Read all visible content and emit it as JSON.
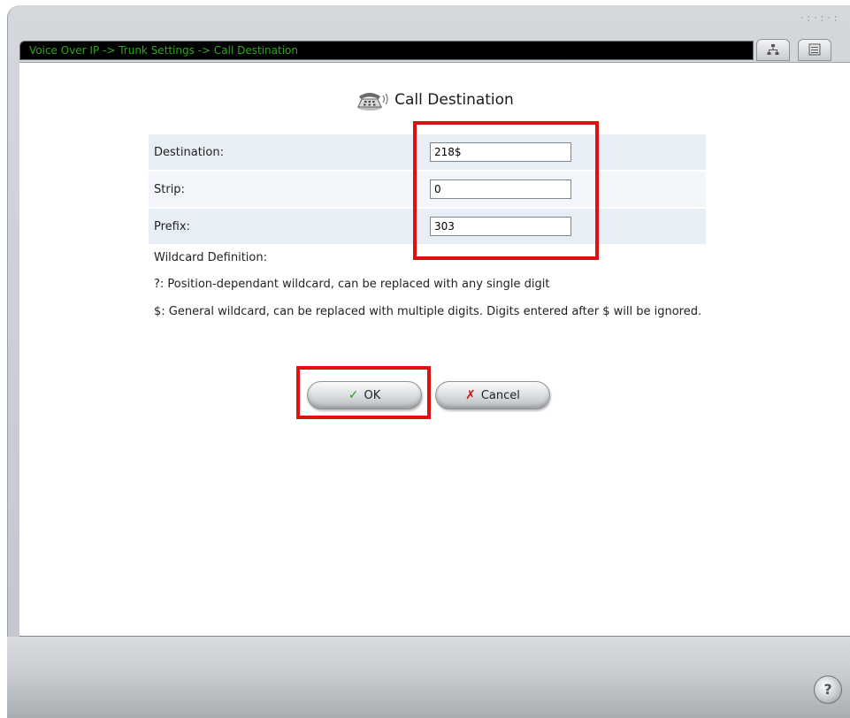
{
  "breadcrumb": "Voice Over IP -> Trunk Settings -> Call Destination",
  "toolbar": {
    "grip_glyphs": "·:·:·:",
    "icons": [
      "network-map-icon",
      "list-view-icon"
    ]
  },
  "page": {
    "title": "Call Destination",
    "title_icon": "telephone-icon"
  },
  "form": {
    "destination": {
      "label": "Destination:",
      "value": "218$"
    },
    "strip": {
      "label": "Strip:",
      "value": "0"
    },
    "prefix": {
      "label": "Prefix:",
      "value": "303"
    }
  },
  "notes": {
    "heading": "Wildcard Definition:",
    "question_wildcard": "?: Position-dependant wildcard, can be replaced with any single digit",
    "dollar_wildcard": "$: General wildcard, can be replaced with multiple digits. Digits entered after $ will be ignored."
  },
  "buttons": {
    "ok_label": "OK",
    "cancel_label": "Cancel"
  },
  "help": {
    "label": "?"
  },
  "colors": {
    "breadcrumb_text": "#2fa81b",
    "highlight": "#e01010",
    "row_background": "#e8eef5"
  }
}
